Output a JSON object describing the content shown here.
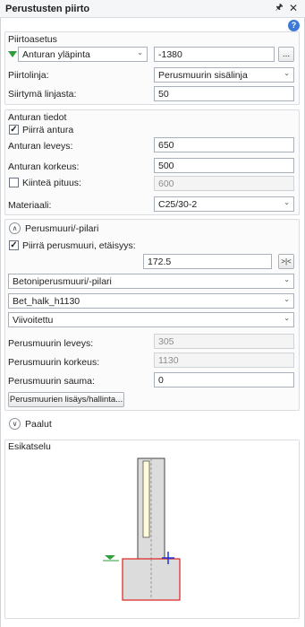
{
  "window": {
    "title": "Perustusten piirto",
    "pin_icon": "pin-icon",
    "close_icon": "close-icon"
  },
  "piirtoasetus": {
    "title": "Piirtoasetus",
    "reference_combo": "Anturan yläpinta",
    "reference_value": "-1380",
    "browse_label": "...",
    "piirtolinja_label": "Piirtolinja:",
    "piirtolinja_value": "Perusmuurin sisälinja",
    "siirtyma_label": "Siirtymä linjasta:",
    "siirtyma_value": "50"
  },
  "antura": {
    "title": "Anturan tiedot",
    "draw_checkbox_label": "Piirrä antura",
    "draw_checked": true,
    "leveys_label": "Anturan leveys:",
    "leveys_value": "650",
    "korkeus_label": "Anturan korkeus:",
    "korkeus_value": "500",
    "kiintea_label": "Kiinteä pituus:",
    "kiintea_checked": false,
    "kiintea_value": "600",
    "materiaali_label": "Materiaali:",
    "materiaali_value": "C25/30-2"
  },
  "perusmuuri": {
    "title": "Perusmuuri/-pilari",
    "expander_icon": "chevron-up-icon",
    "draw_checkbox_label": "Piirrä perusmuuri, etäisyys:",
    "draw_checked": true,
    "distance_value": "172.5",
    "snap_button": ">|<",
    "type_value": "Betoniperusmuuri/-pilari",
    "profile_value": "Bet_halk_h1130",
    "hatch_value": "Viivoitettu",
    "leveys_label": "Perusmuurin leveys:",
    "leveys_value": "305",
    "korkeus_label": "Perusmuurin korkeus:",
    "korkeus_value": "1130",
    "sauma_label": "Perusmuurin sauma:",
    "sauma_value": "0",
    "manage_button": "Perusmuurien lisäys/hallinta..."
  },
  "paalut": {
    "title": "Paalut",
    "expander_icon": "chevron-down-icon"
  },
  "esikatselu": {
    "title": "Esikatselu"
  }
}
